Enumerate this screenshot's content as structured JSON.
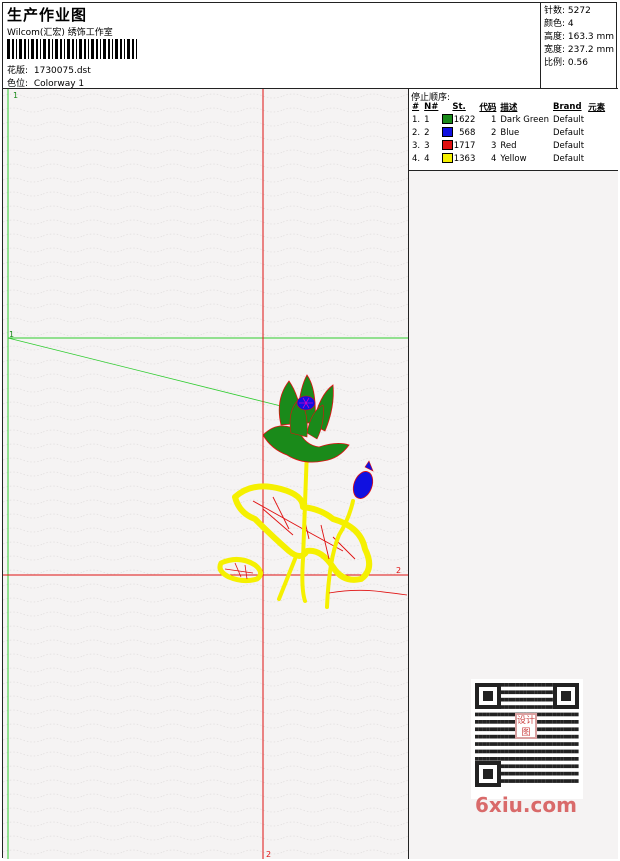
{
  "header": {
    "title": "生产作业图",
    "subtitle": "Wilcom(汇宏) 绣饰工作室",
    "design_label": "花版:",
    "design_value": "1730075.dst",
    "colorway_label": "色位:",
    "colorway_value": "Colorway 1"
  },
  "stats": {
    "stitches": "针数: 5272",
    "colors": "颜色: 4",
    "height": "高度: 163.3 mm",
    "width": "宽度: 237.2 mm",
    "scale": "比例: 0.56"
  },
  "canvas": {
    "marker_top_left": "1",
    "marker_left": "1",
    "marker_right": "2",
    "marker_bottom": "2"
  },
  "stop_sequence": {
    "title": "停止顺序:",
    "headers": [
      "#",
      "N#",
      "St.",
      "代码",
      "描述",
      "Brand",
      "元素"
    ],
    "rows": [
      {
        "num": "1.",
        "n": "1",
        "color": "#1a8a1a",
        "st": "1622",
        "code": "1",
        "desc": "Dark Green",
        "brand": "Default"
      },
      {
        "num": "2.",
        "n": "2",
        "color": "#1010e0",
        "st": "568",
        "code": "2",
        "desc": "Blue",
        "brand": "Default"
      },
      {
        "num": "3.",
        "n": "3",
        "color": "#e01010",
        "st": "1717",
        "code": "3",
        "desc": "Red",
        "brand": "Default"
      },
      {
        "num": "4.",
        "n": "4",
        "color": "#f5f000",
        "st": "1363",
        "code": "4",
        "desc": "Yellow",
        "brand": "Default"
      }
    ]
  },
  "watermark": {
    "stamp_text": "设计图",
    "site": "6xiu.com"
  },
  "colors": {
    "green": "#1a8a1a",
    "blue": "#1010e0",
    "red": "#e01010",
    "yellow": "#f5f000"
  }
}
